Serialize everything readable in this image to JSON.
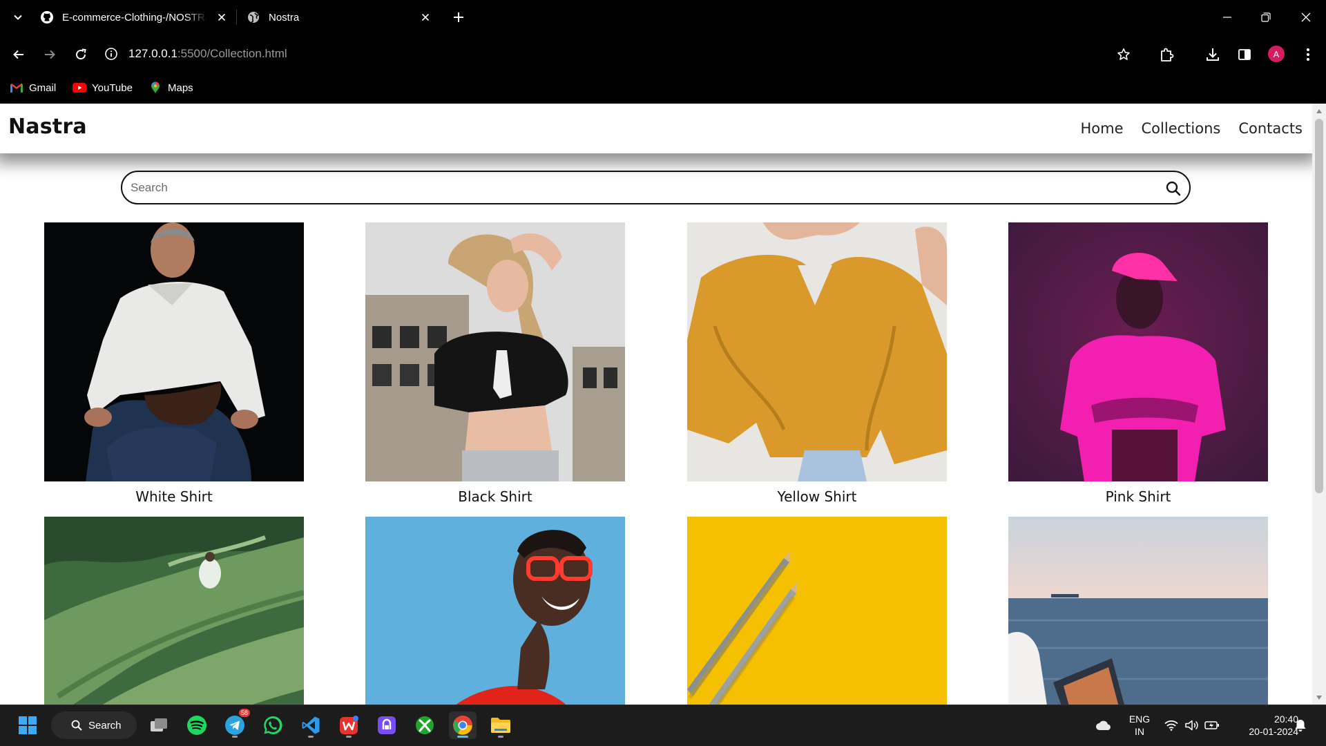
{
  "browser": {
    "tabs": [
      {
        "title": "E-commerce-Clothing-/NOSTRA",
        "icon": "github-icon"
      },
      {
        "title": "Nostra",
        "icon": "globe-icon"
      }
    ],
    "url_host": "127.0.0.1",
    "url_rest": ":5500/Collection.html",
    "profile_initial": "A",
    "bookmarks": [
      {
        "label": "Gmail",
        "icon": "gmail-icon"
      },
      {
        "label": "YouTube",
        "icon": "youtube-icon"
      },
      {
        "label": "Maps",
        "icon": "maps-icon"
      }
    ]
  },
  "site": {
    "brand": "Nastra",
    "nav": [
      "Home",
      "Collections",
      "Contacts"
    ],
    "search_placeholder": "Search",
    "products": [
      {
        "name": "White Shirt"
      },
      {
        "name": "Black Shirt"
      },
      {
        "name": "Yellow Shirt"
      },
      {
        "name": "Pink Shirt"
      },
      {
        "name": ""
      },
      {
        "name": ""
      },
      {
        "name": ""
      },
      {
        "name": ""
      }
    ]
  },
  "taskbar": {
    "search_label": "Search",
    "telegram_badge": "58",
    "lang_top": "ENG",
    "lang_bottom": "IN",
    "time": "20:40",
    "date": "20-01-2024"
  },
  "colors": {
    "chrome_bg": "#000000",
    "page_bg": "#ffffff",
    "avatar": "#d81b60",
    "taskbar_bg": "#1c1c1c"
  }
}
